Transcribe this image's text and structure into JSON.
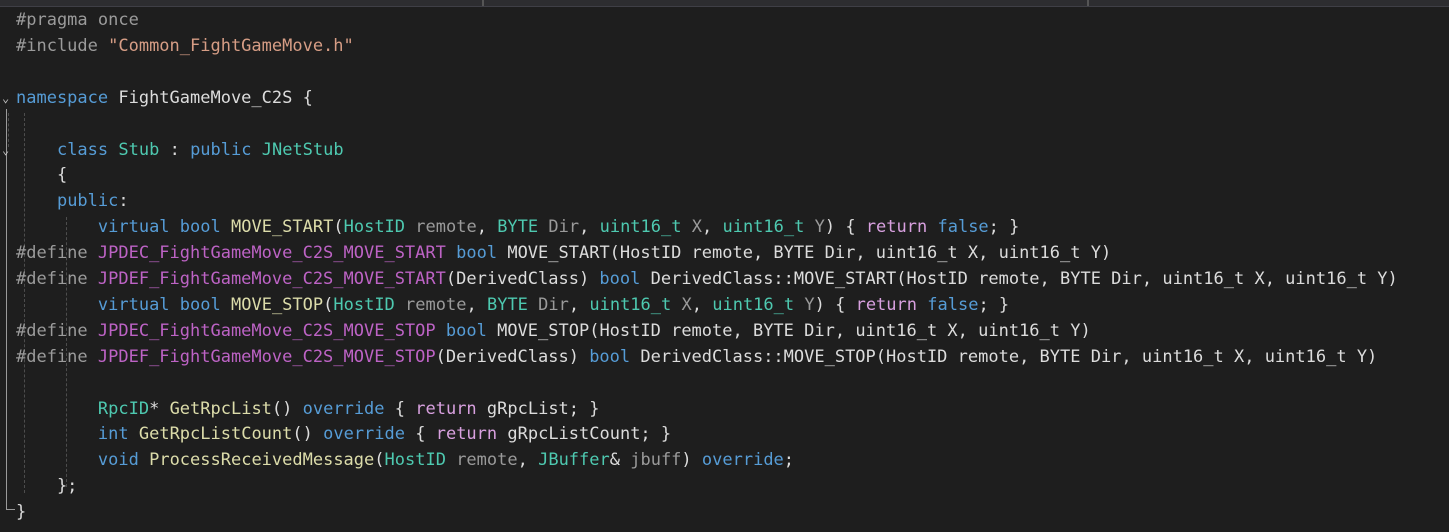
{
  "lines": [
    [
      {
        "c": "pp",
        "t": "#pragma once"
      }
    ],
    [
      {
        "c": "pp",
        "t": "#include "
      },
      {
        "c": "str",
        "t": "\"Common_FightGameMove.h\""
      }
    ],
    [],
    [
      {
        "c": "kw",
        "t": "namespace"
      },
      {
        "c": "txt",
        "t": " FightGameMove_C2S {"
      }
    ],
    [],
    [
      {
        "c": "txt",
        "t": "    "
      },
      {
        "c": "kw",
        "t": "class"
      },
      {
        "c": "txt",
        "t": " "
      },
      {
        "c": "ty",
        "t": "Stub"
      },
      {
        "c": "txt",
        "t": " : "
      },
      {
        "c": "kw",
        "t": "public"
      },
      {
        "c": "txt",
        "t": " "
      },
      {
        "c": "ty",
        "t": "JNetStub"
      }
    ],
    [
      {
        "c": "txt",
        "t": "    {"
      }
    ],
    [
      {
        "c": "txt",
        "t": "    "
      },
      {
        "c": "kw",
        "t": "public"
      },
      {
        "c": "txt",
        "t": ":"
      }
    ],
    [
      {
        "c": "txt",
        "t": "        "
      },
      {
        "c": "kw",
        "t": "virtual"
      },
      {
        "c": "txt",
        "t": " "
      },
      {
        "c": "kw",
        "t": "bool"
      },
      {
        "c": "txt",
        "t": " "
      },
      {
        "c": "fn",
        "t": "MOVE_START"
      },
      {
        "c": "txt",
        "t": "("
      },
      {
        "c": "ty",
        "t": "HostID"
      },
      {
        "c": "txt",
        "t": " "
      },
      {
        "c": "par",
        "t": "remote"
      },
      {
        "c": "txt",
        "t": ", "
      },
      {
        "c": "ty",
        "t": "BYTE"
      },
      {
        "c": "txt",
        "t": " "
      },
      {
        "c": "par",
        "t": "Dir"
      },
      {
        "c": "txt",
        "t": ", "
      },
      {
        "c": "ty",
        "t": "uint16_t"
      },
      {
        "c": "txt",
        "t": " "
      },
      {
        "c": "par",
        "t": "X"
      },
      {
        "c": "txt",
        "t": ", "
      },
      {
        "c": "ty",
        "t": "uint16_t"
      },
      {
        "c": "txt",
        "t": " "
      },
      {
        "c": "par",
        "t": "Y"
      },
      {
        "c": "txt",
        "t": ") { "
      },
      {
        "c": "ctl",
        "t": "return"
      },
      {
        "c": "txt",
        "t": " "
      },
      {
        "c": "kw",
        "t": "false"
      },
      {
        "c": "txt",
        "t": "; }"
      }
    ],
    [
      {
        "c": "pp",
        "t": "#define "
      },
      {
        "c": "mac",
        "t": "JPDEC_FightGameMove_C2S_MOVE_START"
      },
      {
        "c": "txt",
        "t": " "
      },
      {
        "c": "kw",
        "t": "bool"
      },
      {
        "c": "txt",
        "t": " MOVE_START(HostID remote, BYTE Dir, uint16_t X, uint16_t Y)"
      }
    ],
    [
      {
        "c": "pp",
        "t": "#define "
      },
      {
        "c": "mac",
        "t": "JPDEF_FightGameMove_C2S_MOVE_START"
      },
      {
        "c": "txt",
        "t": "(DerivedClass) "
      },
      {
        "c": "kw",
        "t": "bool"
      },
      {
        "c": "txt",
        "t": " DerivedClass::MOVE_START(HostID remote, BYTE Dir, uint16_t X, uint16_t Y)"
      }
    ],
    [
      {
        "c": "txt",
        "t": "        "
      },
      {
        "c": "kw",
        "t": "virtual"
      },
      {
        "c": "txt",
        "t": " "
      },
      {
        "c": "kw",
        "t": "bool"
      },
      {
        "c": "txt",
        "t": " "
      },
      {
        "c": "fn",
        "t": "MOVE_STOP"
      },
      {
        "c": "txt",
        "t": "("
      },
      {
        "c": "ty",
        "t": "HostID"
      },
      {
        "c": "txt",
        "t": " "
      },
      {
        "c": "par",
        "t": "remote"
      },
      {
        "c": "txt",
        "t": ", "
      },
      {
        "c": "ty",
        "t": "BYTE"
      },
      {
        "c": "txt",
        "t": " "
      },
      {
        "c": "par",
        "t": "Dir"
      },
      {
        "c": "txt",
        "t": ", "
      },
      {
        "c": "ty",
        "t": "uint16_t"
      },
      {
        "c": "txt",
        "t": " "
      },
      {
        "c": "par",
        "t": "X"
      },
      {
        "c": "txt",
        "t": ", "
      },
      {
        "c": "ty",
        "t": "uint16_t"
      },
      {
        "c": "txt",
        "t": " "
      },
      {
        "c": "par",
        "t": "Y"
      },
      {
        "c": "txt",
        "t": ") { "
      },
      {
        "c": "ctl",
        "t": "return"
      },
      {
        "c": "txt",
        "t": " "
      },
      {
        "c": "kw",
        "t": "false"
      },
      {
        "c": "txt",
        "t": "; }"
      }
    ],
    [
      {
        "c": "pp",
        "t": "#define "
      },
      {
        "c": "mac",
        "t": "JPDEC_FightGameMove_C2S_MOVE_STOP"
      },
      {
        "c": "txt",
        "t": " "
      },
      {
        "c": "kw",
        "t": "bool"
      },
      {
        "c": "txt",
        "t": " MOVE_STOP(HostID remote, BYTE Dir, uint16_t X, uint16_t Y)"
      }
    ],
    [
      {
        "c": "pp",
        "t": "#define "
      },
      {
        "c": "mac",
        "t": "JPDEF_FightGameMove_C2S_MOVE_STOP"
      },
      {
        "c": "txt",
        "t": "(DerivedClass) "
      },
      {
        "c": "kw",
        "t": "bool"
      },
      {
        "c": "txt",
        "t": " DerivedClass::MOVE_STOP(HostID remote, BYTE Dir, uint16_t X, uint16_t Y)"
      }
    ],
    [],
    [
      {
        "c": "txt",
        "t": "        "
      },
      {
        "c": "ty",
        "t": "RpcID"
      },
      {
        "c": "txt",
        "t": "* "
      },
      {
        "c": "fn",
        "t": "GetRpcList"
      },
      {
        "c": "txt",
        "t": "() "
      },
      {
        "c": "kw",
        "t": "override"
      },
      {
        "c": "txt",
        "t": " { "
      },
      {
        "c": "ctl",
        "t": "return"
      },
      {
        "c": "txt",
        "t": " gRpcList; }"
      }
    ],
    [
      {
        "c": "txt",
        "t": "        "
      },
      {
        "c": "kw",
        "t": "int"
      },
      {
        "c": "txt",
        "t": " "
      },
      {
        "c": "fn",
        "t": "GetRpcListCount"
      },
      {
        "c": "txt",
        "t": "() "
      },
      {
        "c": "kw",
        "t": "override"
      },
      {
        "c": "txt",
        "t": " { "
      },
      {
        "c": "ctl",
        "t": "return"
      },
      {
        "c": "txt",
        "t": " gRpcListCount; }"
      }
    ],
    [
      {
        "c": "txt",
        "t": "        "
      },
      {
        "c": "kw",
        "t": "void"
      },
      {
        "c": "txt",
        "t": " "
      },
      {
        "c": "fn",
        "t": "ProcessReceivedMessage"
      },
      {
        "c": "txt",
        "t": "("
      },
      {
        "c": "ty",
        "t": "HostID"
      },
      {
        "c": "txt",
        "t": " "
      },
      {
        "c": "par",
        "t": "remote"
      },
      {
        "c": "txt",
        "t": ", "
      },
      {
        "c": "ty",
        "t": "JBuffer"
      },
      {
        "c": "txt",
        "t": "& "
      },
      {
        "c": "par",
        "t": "jbuff"
      },
      {
        "c": "txt",
        "t": ") "
      },
      {
        "c": "kw",
        "t": "override"
      },
      {
        "c": "txt",
        "t": ";"
      }
    ],
    [
      {
        "c": "txt",
        "t": "    };"
      }
    ],
    [
      {
        "c": "txt",
        "t": "}"
      }
    ]
  ],
  "fold_markers": [
    {
      "line": 3,
      "glyph": "⌄"
    },
    {
      "line": 5,
      "glyph": "⌄"
    }
  ],
  "colors": {
    "background": "#1e1e1e",
    "keyword": "#569cd6",
    "type": "#4ec9b0",
    "function": "#dcdcaa",
    "string": "#d69d85",
    "preprocessor": "#9b9b9b",
    "macro": "#bd63c5",
    "control": "#d8a0df",
    "parameter": "#9a9a9a",
    "text": "#dcdcdc"
  }
}
